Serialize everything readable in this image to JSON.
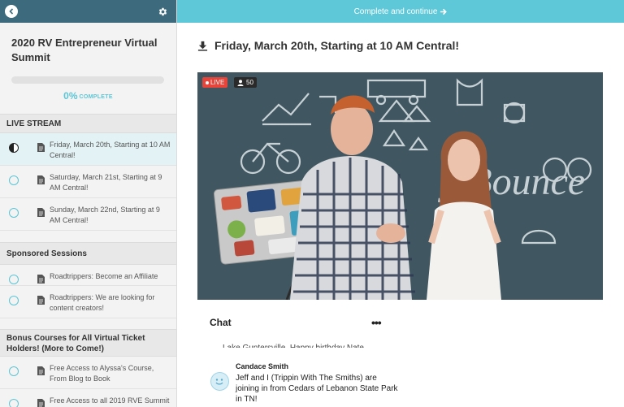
{
  "sidebar": {
    "course_title": "2020 RV Entrepreneur Virtual Summit",
    "progress_percent": "0%",
    "progress_label": "COMPLETE",
    "progress_value": 0,
    "sections": [
      {
        "title": "LIVE STREAM",
        "lessons": [
          {
            "label": "Friday, March 20th, Starting at 10 AM Central!",
            "status": "in-progress",
            "active": true
          },
          {
            "label": "Saturday, March 21st, Starting at 9 AM Central!",
            "status": "not-started",
            "active": false
          },
          {
            "label": "Sunday, March 22nd, Starting at 9 AM Central!",
            "status": "not-started",
            "active": false
          }
        ]
      },
      {
        "title": "Sponsored Sessions",
        "lessons": [
          {
            "label": "Roadtrippers: Become an Affiliate",
            "status": "not-started",
            "active": false
          },
          {
            "label": "Roadtrippers: We are looking for content creators!",
            "status": "not-started",
            "active": false
          }
        ]
      },
      {
        "title": "Bonus Courses for All Virtual Ticket Holders! (More to Come!)",
        "lessons": [
          {
            "label": "Free Access to Alyssa's Course, From Blog to Book",
            "status": "not-started",
            "active": false
          },
          {
            "label": "Free Access to all 2019 RVE Summit",
            "status": "not-started",
            "active": false
          }
        ]
      }
    ]
  },
  "topbar": {
    "complete_label": "Complete and continue"
  },
  "lesson": {
    "title": "Friday, March 20th, Starting at 10 AM Central!"
  },
  "video": {
    "live_label": "LIVE",
    "viewer_count": "50"
  },
  "chat": {
    "title": "Chat",
    "menu_label": "•••",
    "previous_text": "Lake Guntersville. Happy birthday Nate.",
    "message": {
      "author": "Candace Smith",
      "text": "Jeff and I (Trippin With The Smiths) are joining in from Cedars of Lebanon State Park in TN!"
    }
  },
  "colors": {
    "accent": "#5ec8d8",
    "sidebar_header": "#3d6b7d",
    "live": "#e5453a"
  }
}
